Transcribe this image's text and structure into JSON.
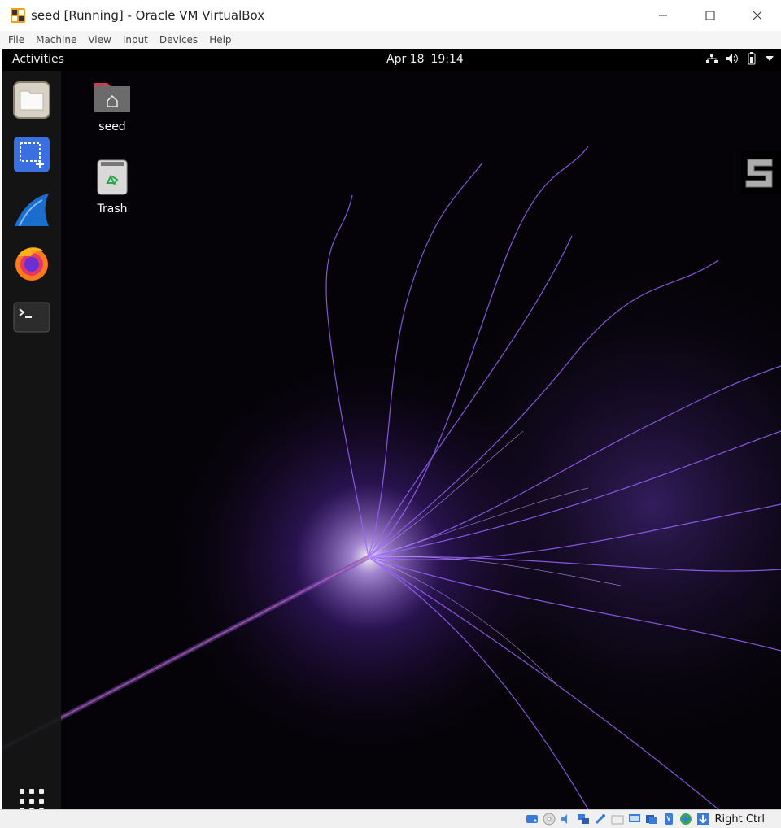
{
  "window": {
    "title": "seed [Running] - Oracle VM VirtualBox",
    "icon": "virtualbox-icon",
    "controls": [
      "minimize-icon",
      "maximize-icon",
      "close-icon"
    ]
  },
  "menu": [
    "File",
    "Machine",
    "View",
    "Input",
    "Devices",
    "Help"
  ],
  "guest": {
    "activities_label": "Activities",
    "clock": {
      "date": "Apr 18",
      "time": "19:14"
    },
    "tray_icons": [
      "network-icon",
      "volume-icon",
      "battery-icon",
      "system-menu-arrow-icon"
    ],
    "dock": [
      {
        "name": "files",
        "icon": "files-icon"
      },
      {
        "name": "screenshot",
        "icon": "screenshot-icon"
      },
      {
        "name": "wireshark",
        "icon": "wireshark-icon"
      },
      {
        "name": "firefox",
        "icon": "firefox-icon"
      },
      {
        "name": "terminal",
        "icon": "terminal-icon"
      }
    ],
    "show_apps_icon": "apps-grid-icon",
    "desktop_icons": [
      {
        "label": "seed",
        "icon": "home-folder-icon"
      },
      {
        "label": "Trash",
        "icon": "trash-icon"
      }
    ],
    "wallpaper": {
      "accent": "#8a4dff",
      "core": "#ffffff"
    }
  },
  "statusbar": {
    "host_key_label": "Right Ctrl",
    "icons": [
      "hard-disk-icon",
      "optical-drive-icon",
      "audio-icon",
      "network-adapter-icon",
      "usb-icon",
      "shared-folders-icon",
      "display-icon",
      "recording-icon",
      "cpu-icon",
      "mouse-integration-icon",
      "keyboard-capture-icon"
    ]
  },
  "colors": {
    "menubar": "#f5f5f5",
    "titlebar": "#ffffff",
    "topbar": "#000000",
    "dock": "#161616"
  }
}
